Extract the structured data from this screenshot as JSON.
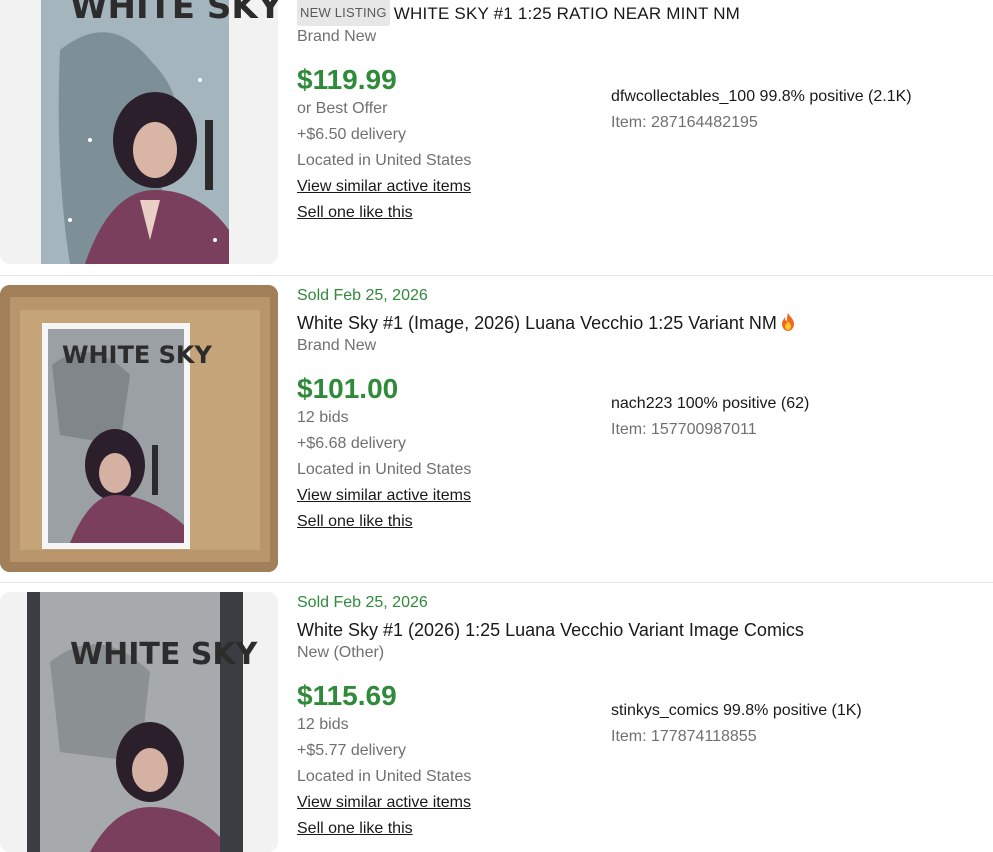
{
  "listings": [
    {
      "badge": "NEW LISTING",
      "title": "WHITE SKY #1 1:25 RATIO NEAR MINT NM",
      "condition": "Brand New",
      "price": "$119.99",
      "bid_info": "or Best Offer",
      "delivery": "+$6.50 delivery",
      "location": "Located in United States",
      "similar_link": "View similar active items",
      "sell_link": "Sell one like this",
      "seller": "dfwcollectables_100 99.8% positive (2.1K)",
      "item_number": "Item: 287164482195",
      "cover_title": "WHITE SKY"
    },
    {
      "sold_date": "Sold Feb 25, 2026",
      "title": "White Sky #1 (Image, 2026) Luana Vecchio 1:25 Variant NM",
      "condition": "Brand New",
      "price": "$101.00",
      "bid_info": "12 bids",
      "delivery": "+$6.68 delivery",
      "location": "Located in United States",
      "similar_link": "View similar active items",
      "sell_link": "Sell one like this",
      "seller": "nach223 100% positive (62)",
      "item_number": "Item: 157700987011",
      "cover_title": "WHITE SKY"
    },
    {
      "sold_date": "Sold Feb 25, 2026",
      "title": "White Sky #1 (2026) 1:25 Luana Vecchio Variant Image Comics",
      "condition": "New (Other)",
      "price": "$115.69",
      "bid_info": "12 bids",
      "delivery": "+$5.77 delivery",
      "location": "Located in United States",
      "similar_link": "View similar active items",
      "sell_link": "Sell one like this",
      "seller": "stinkys_comics 99.8% positive (1K)",
      "item_number": "Item: 177874118855",
      "cover_title": "WHITE SKY"
    }
  ],
  "colors": {
    "price_green": "#2f8a3a",
    "muted_text": "#707070",
    "text": "#191919"
  }
}
